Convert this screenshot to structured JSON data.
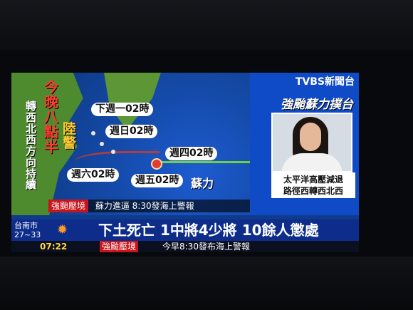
{
  "channel": {
    "name": "TVBS新聞台",
    "headline_tag": "強颱蘇力撲台"
  },
  "map": {
    "vertical_text": {
      "left": "轉西北西方向持續",
      "red": "今晚八點半",
      "yellow": "陸警"
    },
    "forecast_labels": [
      "下週一02時",
      "週日02時",
      "週四02時",
      "週五02時",
      "週六02時"
    ],
    "storm_name": "蘇力"
  },
  "caption": {
    "line1": "太平洋高壓減退",
    "line2": "路徑西轉西北西"
  },
  "small_ticker": {
    "tag": "強颱壓境",
    "text": "蘇力進逼 8:30發海上警報"
  },
  "lower_third": {
    "city": "台南市",
    "temp": "27~33",
    "headline": "下土死亡 1中將4少將 10餘人懲處"
  },
  "bottom_bar": {
    "time": "07:22",
    "tag": "強颱壓境",
    "ticker": "今早8:30發布海上警報"
  }
}
